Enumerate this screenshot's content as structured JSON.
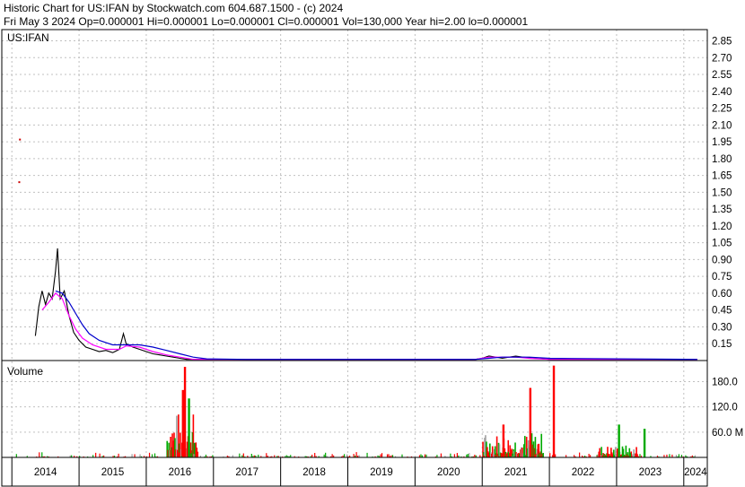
{
  "header": {
    "line1": "Historic Chart for US:IFAN by Stockwatch.com 604.687.1500 - (c) 2024",
    "line2": "Fri May  3 2024  Op=0.000001  Hi=0.000001  Lo=0.000001  Cl=0.000001  Vol=130,000   Year hi=2.00   lo=0.000001"
  },
  "colors": {
    "grid": "#c0c0c0",
    "price": "#000000",
    "ma_short": "#ff00ff",
    "ma_long": "#0000cc",
    "vol_up": "#00aa00",
    "vol_down": "#ff0000",
    "vol_flat": "#a0a0a0",
    "spike": "#cc0000"
  },
  "chart_data": [
    {
      "type": "line",
      "symbol_label": "US:IFAN",
      "ylim": [
        0,
        2.95
      ],
      "y_ticks": [
        "2.85",
        "2.70",
        "2.55",
        "2.40",
        "2.25",
        "2.10",
        "1.95",
        "1.80",
        "1.65",
        "1.50",
        "1.35",
        "1.20",
        "1.05",
        "0.90",
        "0.75",
        "0.60",
        "0.45",
        "0.30",
        "0.15"
      ],
      "y_tick_values": [
        2.85,
        2.7,
        2.55,
        2.4,
        2.25,
        2.1,
        1.95,
        1.8,
        1.65,
        1.5,
        1.35,
        1.2,
        1.05,
        0.9,
        0.75,
        0.6,
        0.45,
        0.3,
        0.15
      ],
      "x_ticks": [
        "2014",
        "2015",
        "2016",
        "2017",
        "2018",
        "2019",
        "2020",
        "2021",
        "2022",
        "2023",
        "2024"
      ],
      "x_tick_values": [
        2014.0,
        2015.0,
        2016.0,
        2017.0,
        2018.0,
        2019.0,
        2020.0,
        2021.0,
        2022.0,
        2023.0,
        2024.0
      ],
      "xlim": [
        2013.85,
        2024.35
      ],
      "outliers": [
        {
          "x": 2014.12,
          "y": 1.97
        },
        {
          "x": 2014.11,
          "y": 1.59
        }
      ],
      "series": [
        {
          "role": "price",
          "x": [
            2014.35,
            2014.4,
            2014.45,
            2014.5,
            2014.55,
            2014.6,
            2014.65,
            2014.68,
            2014.72,
            2014.78,
            2014.85,
            2014.92,
            2015.0,
            2015.1,
            2015.2,
            2015.3,
            2015.4,
            2015.5,
            2015.6,
            2015.66,
            2015.7,
            2015.8,
            2015.9,
            2016.0,
            2016.1,
            2016.2,
            2016.3,
            2016.4,
            2016.5,
            2016.6,
            2017.0,
            2018.0,
            2019.0,
            2020.0,
            2020.9,
            2021.0,
            2021.1,
            2021.2,
            2021.3,
            2021.4,
            2021.5,
            2021.6,
            2021.8,
            2022.0,
            2023.0,
            2024.2
          ],
          "y": [
            0.22,
            0.48,
            0.62,
            0.5,
            0.6,
            0.55,
            0.8,
            1.0,
            0.55,
            0.62,
            0.4,
            0.25,
            0.18,
            0.12,
            0.1,
            0.08,
            0.09,
            0.07,
            0.1,
            0.24,
            0.15,
            0.12,
            0.1,
            0.08,
            0.06,
            0.05,
            0.04,
            0.03,
            0.02,
            0.01,
            0.01,
            0.01,
            0.01,
            0.01,
            0.01,
            0.02,
            0.04,
            0.03,
            0.02,
            0.03,
            0.04,
            0.03,
            0.02,
            0.01,
            0.01,
            0.01
          ]
        },
        {
          "role": "ma_short",
          "x": [
            2014.45,
            2014.55,
            2014.65,
            2014.75,
            2014.85,
            2014.95,
            2015.05,
            2015.2,
            2015.4,
            2015.6,
            2015.7,
            2015.9,
            2016.1,
            2016.3,
            2016.5,
            2016.7,
            2017.5,
            2020.9,
            2021.1,
            2021.3,
            2021.5,
            2021.7,
            2022.0,
            2024.2
          ],
          "y": [
            0.45,
            0.52,
            0.6,
            0.55,
            0.4,
            0.28,
            0.2,
            0.14,
            0.1,
            0.1,
            0.13,
            0.12,
            0.08,
            0.05,
            0.03,
            0.01,
            0.01,
            0.01,
            0.03,
            0.03,
            0.03,
            0.02,
            0.01,
            0.01
          ]
        },
        {
          "role": "ma_long",
          "x": [
            2014.65,
            2014.75,
            2014.85,
            2014.95,
            2015.05,
            2015.15,
            2015.3,
            2015.5,
            2015.7,
            2015.9,
            2016.1,
            2016.3,
            2016.5,
            2016.7,
            2016.9,
            2017.5,
            2020.9,
            2021.1,
            2021.3,
            2021.5,
            2021.7,
            2022.0,
            2024.2
          ],
          "y": [
            0.62,
            0.6,
            0.52,
            0.42,
            0.32,
            0.24,
            0.18,
            0.14,
            0.14,
            0.14,
            0.12,
            0.09,
            0.06,
            0.03,
            0.015,
            0.01,
            0.01,
            0.02,
            0.03,
            0.03,
            0.03,
            0.02,
            0.01
          ]
        }
      ]
    },
    {
      "type": "bar",
      "title": "Volume",
      "ylim": [
        0,
        230
      ],
      "y_ticks": [
        "180.0",
        "120.0",
        "60.0 M"
      ],
      "y_tick_values": [
        180,
        120,
        60
      ],
      "clusters": [
        {
          "x0": 2016.3,
          "x1": 2016.75,
          "peak": 110
        },
        {
          "x0": 2021.0,
          "x1": 2021.9,
          "peak": 60
        },
        {
          "x0": 2022.7,
          "x1": 2023.3,
          "peak": 30
        }
      ],
      "spikes": [
        {
          "x": 2016.56,
          "v": 215,
          "dir": "down"
        },
        {
          "x": 2016.53,
          "v": 160,
          "dir": "down"
        },
        {
          "x": 2016.62,
          "v": 140,
          "dir": "up"
        },
        {
          "x": 2021.7,
          "v": 165,
          "dir": "down"
        },
        {
          "x": 2022.05,
          "v": 218,
          "dir": "down"
        },
        {
          "x": 2021.3,
          "v": 78,
          "dir": "down"
        },
        {
          "x": 2023.02,
          "v": 78,
          "dir": "up"
        },
        {
          "x": 2023.4,
          "v": 68,
          "dir": "up"
        }
      ]
    }
  ]
}
